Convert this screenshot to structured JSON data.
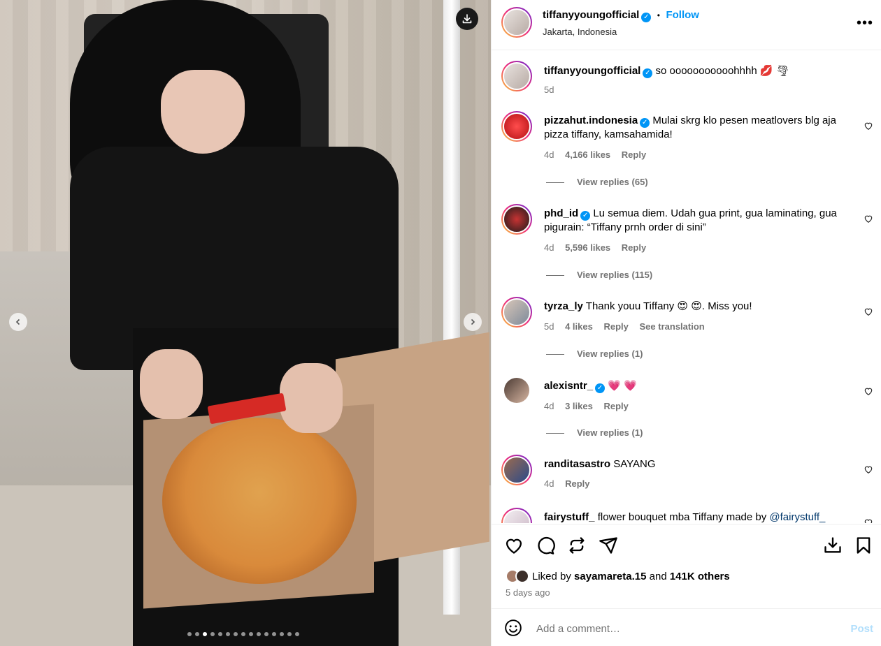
{
  "post": {
    "username": "tiffanyyoungofficial",
    "follow_label": "Follow",
    "location": "Jakarta, Indonesia",
    "carousel_count": 15,
    "carousel_active": 2
  },
  "caption": {
    "username": "tiffanyyoungofficial",
    "text": "so ooooooooooohhhh 💋 🌪",
    "time": "5d"
  },
  "comments": [
    {
      "username": "pizzahut.indonesia",
      "verified": true,
      "text": "Mulai skrg klo pesen meatlovers blg aja pizza tiffany, kamsahamida!",
      "time": "4d",
      "likes": "4,166 likes",
      "reply": "Reply",
      "view_replies": "View replies (65)"
    },
    {
      "username": "phd_id",
      "verified": true,
      "text": "Lu semua diem. Udah gua print, gua laminating, gua pigurain: “Tiffany prnh order di sini”",
      "time": "4d",
      "likes": "5,596 likes",
      "reply": "Reply",
      "view_replies": "View replies (115)"
    },
    {
      "username": "tyrza_ly",
      "verified": false,
      "text": "Thank youu Tiffany 😍 😍. Miss you!",
      "time": "5d",
      "likes": "4 likes",
      "reply": "Reply",
      "translate": "See translation",
      "view_replies": "View replies (1)"
    },
    {
      "username": "alexisntr_",
      "verified": true,
      "text": "💗 💗",
      "time": "4d",
      "likes": "3 likes",
      "reply": "Reply",
      "view_replies": "View replies (1)"
    },
    {
      "username": "randitasastro",
      "verified": false,
      "text": "SAYANG",
      "time": "4d",
      "reply": "Reply"
    },
    {
      "username": "fairystuff_",
      "verified": false,
      "text": "flower bouquet mba Tiffany made by",
      "mention": "@fairystuff_"
    }
  ],
  "liked_by": {
    "prefix": "Liked by",
    "user": "sayamareta.15",
    "middle": "and",
    "others": "141K others"
  },
  "posted_ago": "5 days ago",
  "comment_box": {
    "placeholder": "Add a comment…",
    "post_label": "Post"
  },
  "colors": {
    "link_blue": "#0095f6",
    "muted": "#737373",
    "heart_red": "#ff3040"
  }
}
